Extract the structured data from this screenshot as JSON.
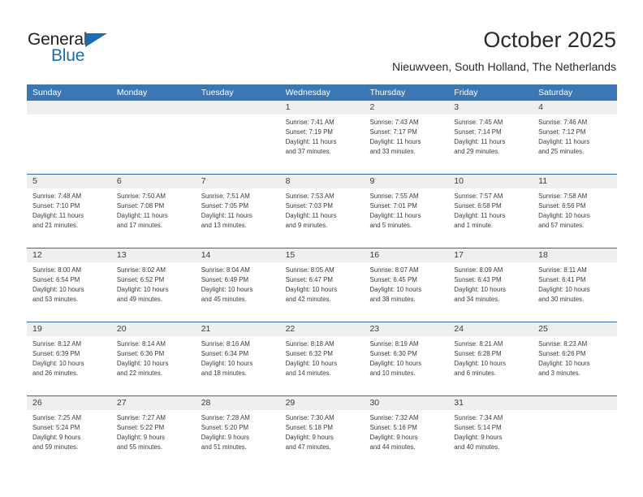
{
  "brand": {
    "name_top": "General",
    "name_bottom": "Blue",
    "triangle_icon": "triangle-icon",
    "color_dark": "#231f20",
    "color_blue": "#1b6cb5"
  },
  "header": {
    "title": "October 2025",
    "subtitle": "Nieuwveen, South Holland, The Netherlands"
  },
  "calendar": {
    "header_bg": "#3a78b5",
    "date_band_bg": "#efefef",
    "row_divider": "#2e6ca8",
    "weekdays": [
      "Sunday",
      "Monday",
      "Tuesday",
      "Wednesday",
      "Thursday",
      "Friday",
      "Saturday"
    ],
    "weeks": [
      {
        "days": [
          {
            "date": "",
            "lines": []
          },
          {
            "date": "",
            "lines": []
          },
          {
            "date": "",
            "lines": []
          },
          {
            "date": "1",
            "lines": [
              "Sunrise: 7:41 AM",
              "Sunset: 7:19 PM",
              "Daylight: 11 hours",
              "and 37 minutes."
            ]
          },
          {
            "date": "2",
            "lines": [
              "Sunrise: 7:43 AM",
              "Sunset: 7:17 PM",
              "Daylight: 11 hours",
              "and 33 minutes."
            ]
          },
          {
            "date": "3",
            "lines": [
              "Sunrise: 7:45 AM",
              "Sunset: 7:14 PM",
              "Daylight: 11 hours",
              "and 29 minutes."
            ]
          },
          {
            "date": "4",
            "lines": [
              "Sunrise: 7:46 AM",
              "Sunset: 7:12 PM",
              "Daylight: 11 hours",
              "and 25 minutes."
            ]
          }
        ]
      },
      {
        "days": [
          {
            "date": "5",
            "lines": [
              "Sunrise: 7:48 AM",
              "Sunset: 7:10 PM",
              "Daylight: 11 hours",
              "and 21 minutes."
            ]
          },
          {
            "date": "6",
            "lines": [
              "Sunrise: 7:50 AM",
              "Sunset: 7:08 PM",
              "Daylight: 11 hours",
              "and 17 minutes."
            ]
          },
          {
            "date": "7",
            "lines": [
              "Sunrise: 7:51 AM",
              "Sunset: 7:05 PM",
              "Daylight: 11 hours",
              "and 13 minutes."
            ]
          },
          {
            "date": "8",
            "lines": [
              "Sunrise: 7:53 AM",
              "Sunset: 7:03 PM",
              "Daylight: 11 hours",
              "and 9 minutes."
            ]
          },
          {
            "date": "9",
            "lines": [
              "Sunrise: 7:55 AM",
              "Sunset: 7:01 PM",
              "Daylight: 11 hours",
              "and 5 minutes."
            ]
          },
          {
            "date": "10",
            "lines": [
              "Sunrise: 7:57 AM",
              "Sunset: 6:58 PM",
              "Daylight: 11 hours",
              "and 1 minute."
            ]
          },
          {
            "date": "11",
            "lines": [
              "Sunrise: 7:58 AM",
              "Sunset: 6:56 PM",
              "Daylight: 10 hours",
              "and 57 minutes."
            ]
          }
        ]
      },
      {
        "days": [
          {
            "date": "12",
            "lines": [
              "Sunrise: 8:00 AM",
              "Sunset: 6:54 PM",
              "Daylight: 10 hours",
              "and 53 minutes."
            ]
          },
          {
            "date": "13",
            "lines": [
              "Sunrise: 8:02 AM",
              "Sunset: 6:52 PM",
              "Daylight: 10 hours",
              "and 49 minutes."
            ]
          },
          {
            "date": "14",
            "lines": [
              "Sunrise: 8:04 AM",
              "Sunset: 6:49 PM",
              "Daylight: 10 hours",
              "and 45 minutes."
            ]
          },
          {
            "date": "15",
            "lines": [
              "Sunrise: 8:05 AM",
              "Sunset: 6:47 PM",
              "Daylight: 10 hours",
              "and 42 minutes."
            ]
          },
          {
            "date": "16",
            "lines": [
              "Sunrise: 8:07 AM",
              "Sunset: 6:45 PM",
              "Daylight: 10 hours",
              "and 38 minutes."
            ]
          },
          {
            "date": "17",
            "lines": [
              "Sunrise: 8:09 AM",
              "Sunset: 6:43 PM",
              "Daylight: 10 hours",
              "and 34 minutes."
            ]
          },
          {
            "date": "18",
            "lines": [
              "Sunrise: 8:11 AM",
              "Sunset: 6:41 PM",
              "Daylight: 10 hours",
              "and 30 minutes."
            ]
          }
        ]
      },
      {
        "days": [
          {
            "date": "19",
            "lines": [
              "Sunrise: 8:12 AM",
              "Sunset: 6:39 PM",
              "Daylight: 10 hours",
              "and 26 minutes."
            ]
          },
          {
            "date": "20",
            "lines": [
              "Sunrise: 8:14 AM",
              "Sunset: 6:36 PM",
              "Daylight: 10 hours",
              "and 22 minutes."
            ]
          },
          {
            "date": "21",
            "lines": [
              "Sunrise: 8:16 AM",
              "Sunset: 6:34 PM",
              "Daylight: 10 hours",
              "and 18 minutes."
            ]
          },
          {
            "date": "22",
            "lines": [
              "Sunrise: 8:18 AM",
              "Sunset: 6:32 PM",
              "Daylight: 10 hours",
              "and 14 minutes."
            ]
          },
          {
            "date": "23",
            "lines": [
              "Sunrise: 8:19 AM",
              "Sunset: 6:30 PM",
              "Daylight: 10 hours",
              "and 10 minutes."
            ]
          },
          {
            "date": "24",
            "lines": [
              "Sunrise: 8:21 AM",
              "Sunset: 6:28 PM",
              "Daylight: 10 hours",
              "and 6 minutes."
            ]
          },
          {
            "date": "25",
            "lines": [
              "Sunrise: 8:23 AM",
              "Sunset: 6:26 PM",
              "Daylight: 10 hours",
              "and 3 minutes."
            ]
          }
        ]
      },
      {
        "days": [
          {
            "date": "26",
            "lines": [
              "Sunrise: 7:25 AM",
              "Sunset: 5:24 PM",
              "Daylight: 9 hours",
              "and 59 minutes."
            ]
          },
          {
            "date": "27",
            "lines": [
              "Sunrise: 7:27 AM",
              "Sunset: 5:22 PM",
              "Daylight: 9 hours",
              "and 55 minutes."
            ]
          },
          {
            "date": "28",
            "lines": [
              "Sunrise: 7:28 AM",
              "Sunset: 5:20 PM",
              "Daylight: 9 hours",
              "and 51 minutes."
            ]
          },
          {
            "date": "29",
            "lines": [
              "Sunrise: 7:30 AM",
              "Sunset: 5:18 PM",
              "Daylight: 9 hours",
              "and 47 minutes."
            ]
          },
          {
            "date": "30",
            "lines": [
              "Sunrise: 7:32 AM",
              "Sunset: 5:16 PM",
              "Daylight: 9 hours",
              "and 44 minutes."
            ]
          },
          {
            "date": "31",
            "lines": [
              "Sunrise: 7:34 AM",
              "Sunset: 5:14 PM",
              "Daylight: 9 hours",
              "and 40 minutes."
            ]
          },
          {
            "date": "",
            "lines": []
          }
        ]
      }
    ]
  }
}
